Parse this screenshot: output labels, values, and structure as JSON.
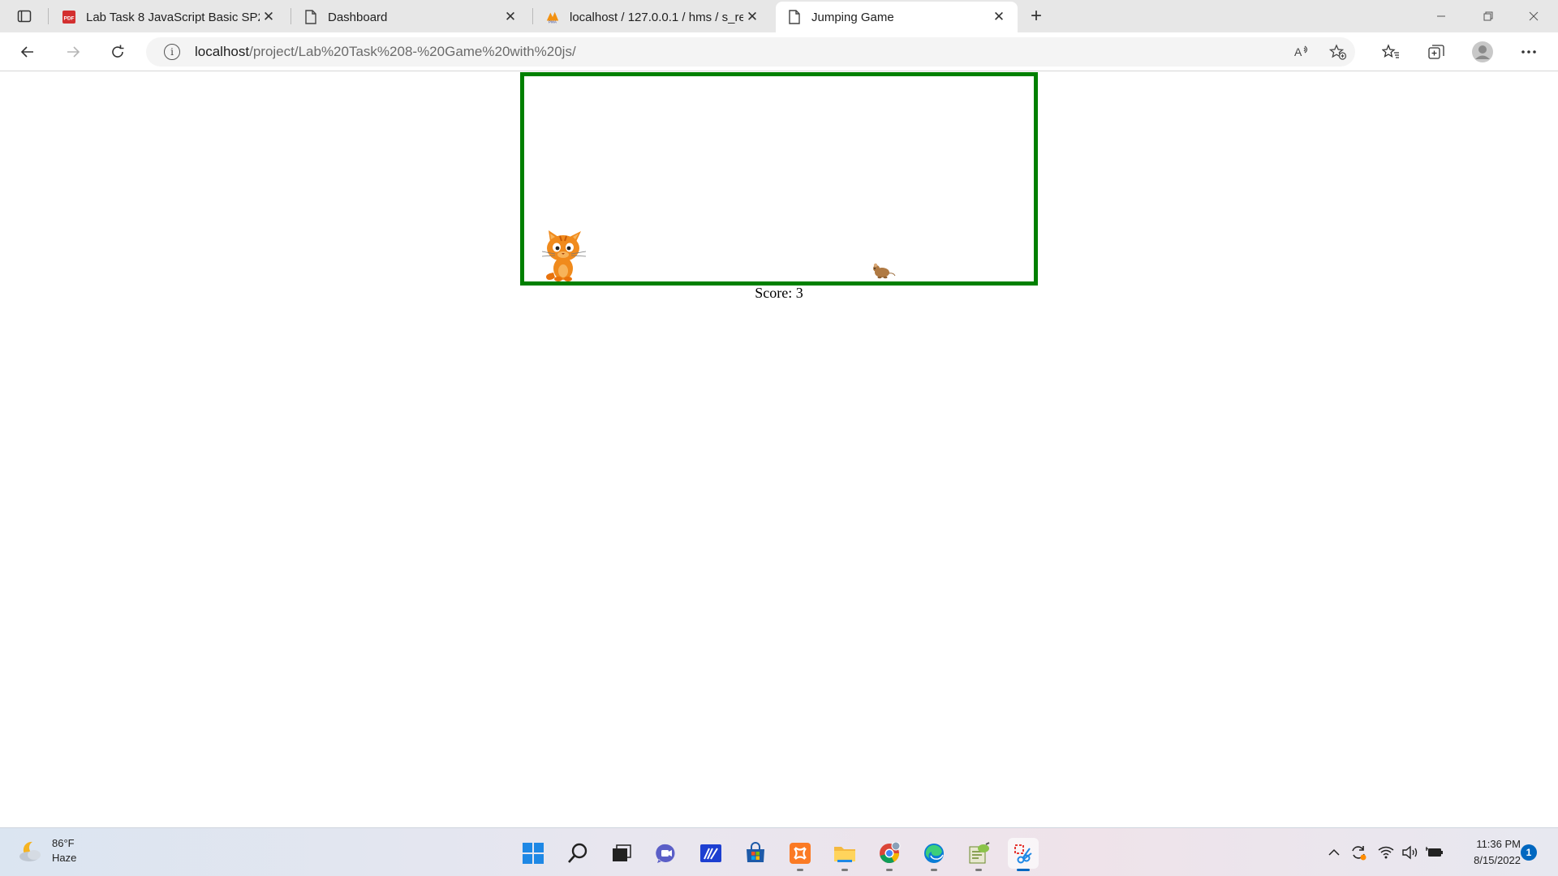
{
  "browser": {
    "tabs": [
      {
        "label": "Lab Task 8 JavaScript Basic SP21-",
        "favicon": "pdf-icon",
        "active": false
      },
      {
        "label": "Dashboard",
        "favicon": "page-icon",
        "active": false
      },
      {
        "label": "localhost / 127.0.0.1 / hms / s_re",
        "favicon": "phpmyadmin-icon",
        "active": false
      },
      {
        "label": "Jumping Game",
        "favicon": "page-icon",
        "active": true
      }
    ],
    "new_tab_symbol": "+",
    "address": {
      "host": "localhost",
      "path": "/project/Lab%20Task%208-%20Game%20with%20js/"
    }
  },
  "game": {
    "score_label": "Score: 3",
    "border_color": "#008000"
  },
  "taskbar": {
    "weather": {
      "temp": "86°F",
      "condition": "Haze"
    },
    "clock": {
      "time": "11:36 PM",
      "date": "8/15/2022"
    },
    "notification_count": "1",
    "apps": [
      "start-icon",
      "search-icon",
      "task-view-icon",
      "chat-icon",
      "editor-icon",
      "store-icon",
      "xampp-icon",
      "file-explorer-icon",
      "chrome-icon",
      "edge-icon",
      "notepad-plus-icon",
      "snipping-tool-icon"
    ]
  }
}
